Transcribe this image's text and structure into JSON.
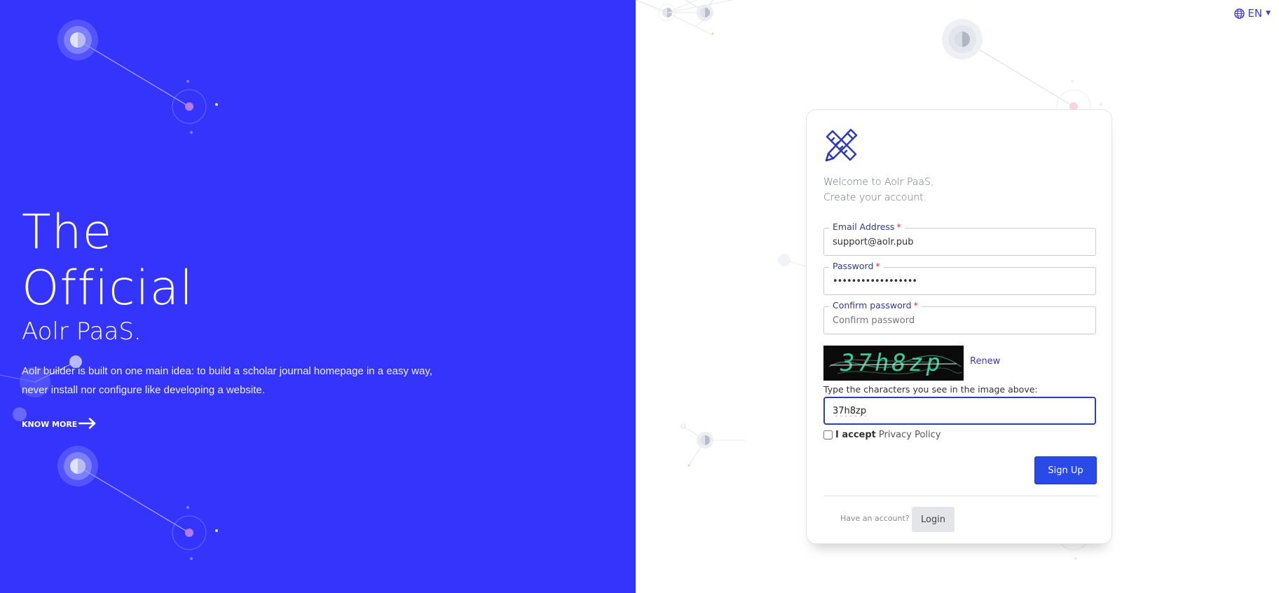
{
  "hero": {
    "title_line1": "The",
    "title_line2": "Official",
    "title_line3": "Aolr PaaS.",
    "description": "Aolr builder is built on one main idea: to build a scholar journal homepage in a easy way, never install nor configure like developing a website.",
    "know_more": "KNOW MORE",
    "background_color": "#3434fc"
  },
  "language": {
    "selected": "EN",
    "icon": "globe-icon"
  },
  "form": {
    "logo_icon": "pencil-ruler-icon",
    "welcome_line1": "Welcome to Aolr PaaS,",
    "welcome_line2": "Create your account.",
    "email": {
      "label": "Email Address",
      "required_mark": "*",
      "value": "support@aolr.pub"
    },
    "password": {
      "label": "Password",
      "required_mark": "*",
      "value": "••••••••••••••••••"
    },
    "confirm_password": {
      "label": "Confirm password",
      "required_mark": "*",
      "value": "",
      "placeholder": "Confirm password"
    },
    "captcha": {
      "image_text": "37h8zp",
      "renew_label": "Renew",
      "hint": "Type the characters you see in the image above:",
      "value": "37h8zp"
    },
    "accept": {
      "label": "I accept",
      "policy_link": "Privacy Policy",
      "checked": false
    },
    "signup_label": "Sign Up",
    "have_account": "Have an account?",
    "login_label": "Login",
    "accent_color": "#2a4ae8"
  }
}
